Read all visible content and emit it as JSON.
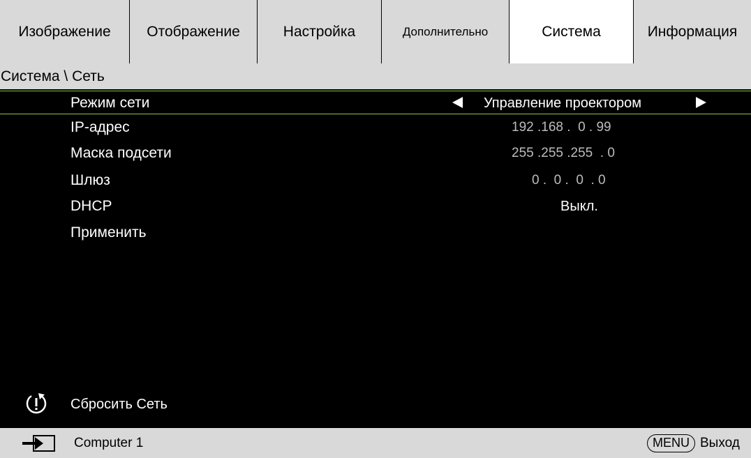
{
  "tabs": [
    {
      "label": "Изображение"
    },
    {
      "label": "Отображение"
    },
    {
      "label": "Настройка"
    },
    {
      "label": "Дополнительно"
    },
    {
      "label": "Система"
    },
    {
      "label": "Информация"
    }
  ],
  "active_tab": "Система",
  "breadcrumb": "Система \\ Сеть",
  "rows": [
    {
      "label": "Режим сети",
      "value": "Управление проектором"
    },
    {
      "label": "IP-адрес",
      "value": "192 .168 .  0 . 99"
    },
    {
      "label": "Маска подсети",
      "value": "255 .255 .255  . 0"
    },
    {
      "label": "Шлюз",
      "value": "0 .  0 .  0  . 0"
    },
    {
      "label": "DHCP",
      "value": "Выкл."
    },
    {
      "label": "Применить",
      "value": ""
    }
  ],
  "reset": {
    "label": "Сбросить Сеть",
    "icon": "power-reset-icon"
  },
  "footer": {
    "source_icon": "input-source-icon",
    "source_label": "Computer 1",
    "menu_key": "MENU",
    "exit_label": "Выход"
  },
  "colors": {
    "selection_border": "#8bc34a",
    "background": "#000000",
    "bar": "#d9d9d9"
  }
}
